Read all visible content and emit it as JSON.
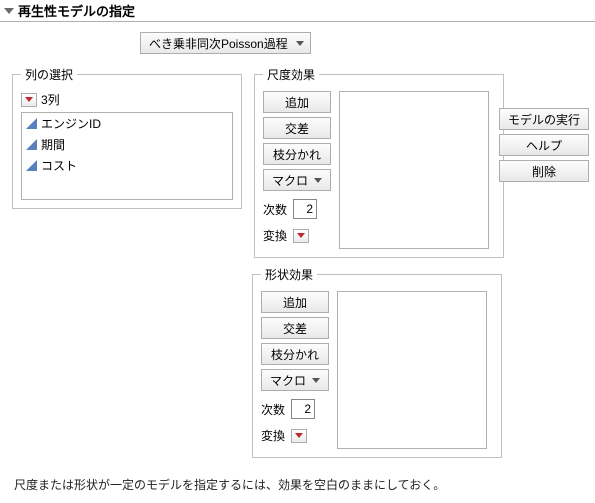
{
  "header": {
    "title": "再生性モデルの指定"
  },
  "model_combo": {
    "selected": "べき乗非同次Poisson過程"
  },
  "col_select": {
    "legend": "列の選択",
    "count_label": "3列",
    "items": [
      "エンジンID",
      "期間",
      "コスト"
    ]
  },
  "scale": {
    "legend": "尺度効果",
    "buttons": {
      "add": "追加",
      "cross": "交差",
      "nest": "枝分かれ",
      "macro": "マクロ"
    },
    "degree_label": "次数",
    "degree_value": "2",
    "transform_label": "変換"
  },
  "shape": {
    "legend": "形状効果",
    "buttons": {
      "add": "追加",
      "cross": "交差",
      "nest": "枝分かれ",
      "macro": "マクロ"
    },
    "degree_label": "次数",
    "degree_value": "2",
    "transform_label": "変換"
  },
  "actions": {
    "run": "モデルの実行",
    "help": "ヘルプ",
    "delete": "削除"
  },
  "footer": "尺度または形状が一定のモデルを指定するには、効果を空白のままにしておく。"
}
